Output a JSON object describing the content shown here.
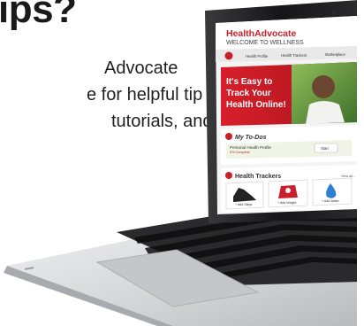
{
  "page": {
    "headline": "ips?",
    "body_lines": [
      "Advocate",
      "e for helpful tip",
      "tutorials, and"
    ]
  },
  "site": {
    "brand_main": "HealthAdvocate",
    "brand_sub": "WELCOME TO WELLNESS",
    "nav": [
      "Health Profile",
      "Health Trackers",
      "Marketplace"
    ],
    "hero_lines": [
      "It's Easy to",
      "Track Your",
      "Health Online!"
    ],
    "todo_title": "My To-Dos",
    "todo_item": "Personal Health Profile",
    "todo_sub": "0% Complete",
    "todo_button": "Start",
    "trackers_title": "Health Trackers",
    "trackers_view_all": "View all...",
    "tracker_labels": [
      "+ Add Steps",
      "+ Add Weight",
      "+ Add Water"
    ]
  },
  "colors": {
    "brand_red": "#c8202a",
    "laptop_silver": "#d9dadc",
    "laptop_dark": "#1d1d1f",
    "water_blue": "#2f7fd1"
  }
}
